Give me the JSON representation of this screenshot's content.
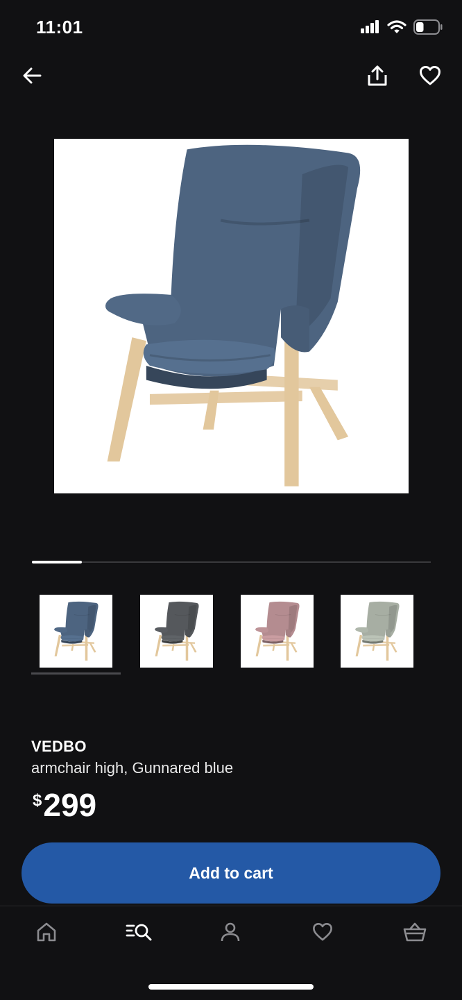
{
  "status_bar": {
    "time": "11:01",
    "icons": [
      "cellular-signal-icon",
      "wifi-icon",
      "battery-icon"
    ],
    "battery_level": 0.35
  },
  "nav": {
    "icons": [
      "back-arrow-icon",
      "share-icon",
      "heart-icon"
    ]
  },
  "gallery": {
    "progress": 0.125,
    "selected_index": 0,
    "thumbnails": [
      {
        "color_name": "Gunnared blue",
        "fabric": "#4d6480"
      },
      {
        "color_name": "Gunnared dark grey",
        "fabric": "#55585c"
      },
      {
        "color_name": "Gunnared light brown-pink",
        "fabric": "#b48c90"
      },
      {
        "color_name": "Gunnared light green",
        "fabric": "#a7aea3"
      }
    ],
    "main_image_fabric": "#4d6480",
    "wood_color": "#e2c79c"
  },
  "product": {
    "name": "VEDBO",
    "description": "armchair high, Gunnared blue",
    "currency": "$",
    "price": "299"
  },
  "cart_button": {
    "label": "Add to cart",
    "color": "#2459a6"
  },
  "tab_bar": {
    "active_index": 1,
    "items": [
      {
        "icon": "home-icon"
      },
      {
        "icon": "search-icon"
      },
      {
        "icon": "profile-icon"
      },
      {
        "icon": "heart-icon"
      },
      {
        "icon": "basket-icon"
      }
    ],
    "active_color": "#ffffff",
    "inactive_color": "#8c8c90"
  }
}
